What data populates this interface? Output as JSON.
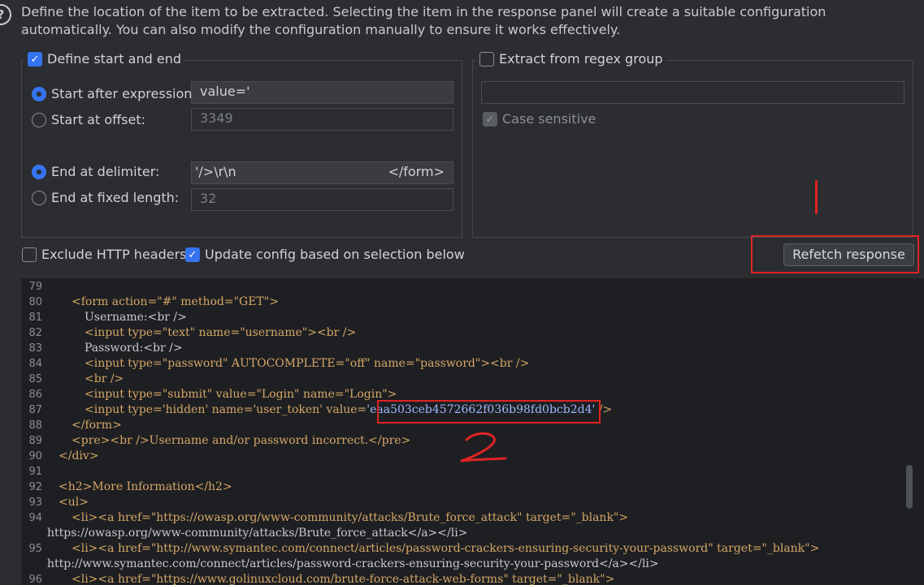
{
  "description": "Define the location of the item to be extracted. Selecting the item in the response panel will create a suitable configuration automatically. You can also modify the configuration manually to ensure it works effectively.",
  "left_panel": {
    "title": "Define start and end",
    "checked": true,
    "start_after_label": "Start after expression:",
    "start_after_value": "value='",
    "start_offset_label": "Start at offset:",
    "start_offset_value": "3349",
    "end_delim_label": "End at delimiter:",
    "end_delim_value": "'/>\\r\\n",
    "end_delim_value2": "</form>",
    "end_fixed_label": "End at fixed length:",
    "end_fixed_value": "32"
  },
  "right_panel": {
    "title": "Extract from regex group",
    "checked": false,
    "regex_value": "",
    "case_sensitive_label": "Case sensitive",
    "case_sensitive_checked": true
  },
  "options": {
    "exclude_headers_label": "Exclude HTTP headers",
    "exclude_headers_checked": false,
    "update_config_label": "Update config based on selection below",
    "update_config_checked": true,
    "refetch_label": "Refetch response"
  },
  "annotations": {
    "mark1": "1",
    "mark2": "2"
  },
  "code": {
    "lines": [
      {
        "n": "79"
      },
      {
        "n": "80"
      },
      {
        "n": "81"
      },
      {
        "n": "82"
      },
      {
        "n": "83"
      },
      {
        "n": "84"
      },
      {
        "n": "85"
      },
      {
        "n": "86"
      },
      {
        "n": "87"
      },
      {
        "n": "88"
      },
      {
        "n": "89"
      },
      {
        "n": "90"
      },
      {
        "n": "91"
      },
      {
        "n": "92"
      },
      {
        "n": "93"
      },
      {
        "n": "94"
      },
      {
        "n": "95"
      },
      {
        "n": "96"
      }
    ],
    "text": {
      "l80": "<form action=\"#\" method=\"GET\">",
      "l81": "Username:<br />",
      "l82": "<input type=\"text\" name=\"username\"><br />",
      "l83": "Password:<br />",
      "l84": "<input type=\"password\" AUTOCOMPLETE=\"off\" name=\"password\"><br />",
      "l85": "<br />",
      "l86": "<input type=\"submit\" value=\"Login\" name=\"Login\">",
      "l87a": "<input type='hidden' name='user_token' value=",
      "l87b": "'eaa503ceb4572662f036b98fd0bcb2d4'",
      "l87c": " />",
      "l88": "</form>",
      "l89": "<pre><br />Username and/or password incorrect.</pre>",
      "l90": "</div>",
      "l92": "<h2>More Information</h2>",
      "l93": "<ul>",
      "l94a": "<li><a href=\"https://owasp.org/www-community/attacks/Brute_force_attack\" target=\"_blank\">",
      "l94b": "https://owasp.org/www-community/attacks/Brute_force_attack</a></li>",
      "l95a": "<li><a href=\"http://www.symantec.com/connect/articles/password-crackers-ensuring-security-your-password\" target=\"_blank\">",
      "l95b": "http://www.symantec.com/connect/articles/password-crackers-ensuring-security-your-password</a></li>",
      "l96": "<li><a href=\"https://www.golinuxcloud.com/brute-force-attack-web-forms\" target=\"_blank\">"
    }
  }
}
